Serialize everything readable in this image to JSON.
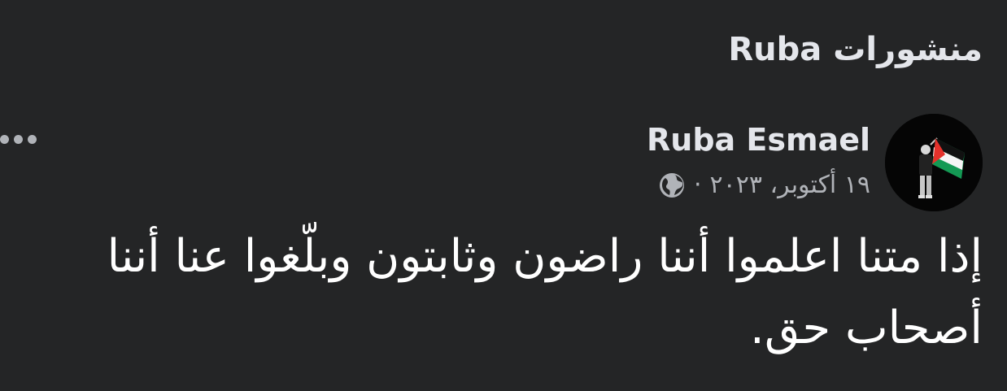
{
  "header": {
    "section_title": "منشورات Ruba"
  },
  "post": {
    "author_name": "Ruba Esmael",
    "date": "١٩ أكتوبر، ٢٠٢٣",
    "separator": "·",
    "audience_icon": "globe-icon",
    "text": "إذا متنا اعلموا أننا راضون وثابتون وبلّغوا عنا أننا أصحاب حق.",
    "more_icon": "more-horizontal-icon",
    "avatar_icon": "palestine-flag-avatar"
  },
  "colors": {
    "background": "#242526",
    "primary_text": "#e4e6eb",
    "secondary_text": "#b0b3b8",
    "flag_red": "#e4312b",
    "flag_green": "#149954"
  }
}
